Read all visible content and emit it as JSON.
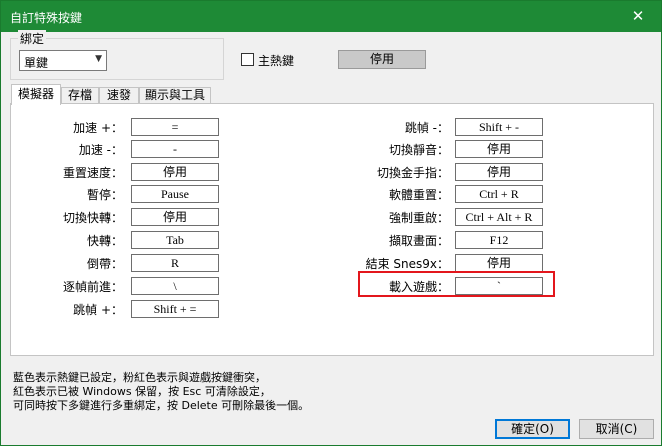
{
  "window": {
    "title": "自訂特殊按鍵",
    "close_icon": "✕"
  },
  "binding": {
    "group_label": "綁定",
    "selected": "單鍵",
    "hotkey_label": "主熱鍵",
    "hotkey_value": "停用"
  },
  "tabs": [
    "模擬器",
    "存檔",
    "速發",
    "顯示與工具"
  ],
  "left_keys": [
    {
      "label": "加速 +：",
      "value": "="
    },
    {
      "label": "加速 -：",
      "value": "-"
    },
    {
      "label": "重置速度：",
      "value": "停用"
    },
    {
      "label": "暫停：",
      "value": "Pause"
    },
    {
      "label": "切換快轉：",
      "value": "停用"
    },
    {
      "label": "快轉：",
      "value": "Tab"
    },
    {
      "label": "倒帶：",
      "value": "R"
    },
    {
      "label": "逐幀前進：",
      "value": "\\"
    },
    {
      "label": "跳幀 +：",
      "value": "Shift + ="
    }
  ],
  "right_keys": [
    {
      "label": "跳幀 -：",
      "value": "Shift + -"
    },
    {
      "label": "切換靜音：",
      "value": "停用"
    },
    {
      "label": "切換金手指：",
      "value": "停用"
    },
    {
      "label": "軟體重置：",
      "value": "Ctrl + R"
    },
    {
      "label": "強制重啟：",
      "value": "Ctrl + Alt + R"
    },
    {
      "label": "擷取畫面：",
      "value": "F12"
    },
    {
      "label": "結束 Snes9x：",
      "value": "停用"
    },
    {
      "label": "載入遊戲：",
      "value": "`"
    }
  ],
  "notes": [
    "藍色表示熱鍵已設定，粉紅色表示與遊戲按鍵衝突，",
    "紅色表示已被 Windows 保留，按 Esc 可清除設定，",
    "可同時按下多鍵進行多重綁定，按 Delete 可刪除最後一個。"
  ],
  "buttons": {
    "ok_label": "確定(O)",
    "cancel_label": "取消(C)"
  }
}
